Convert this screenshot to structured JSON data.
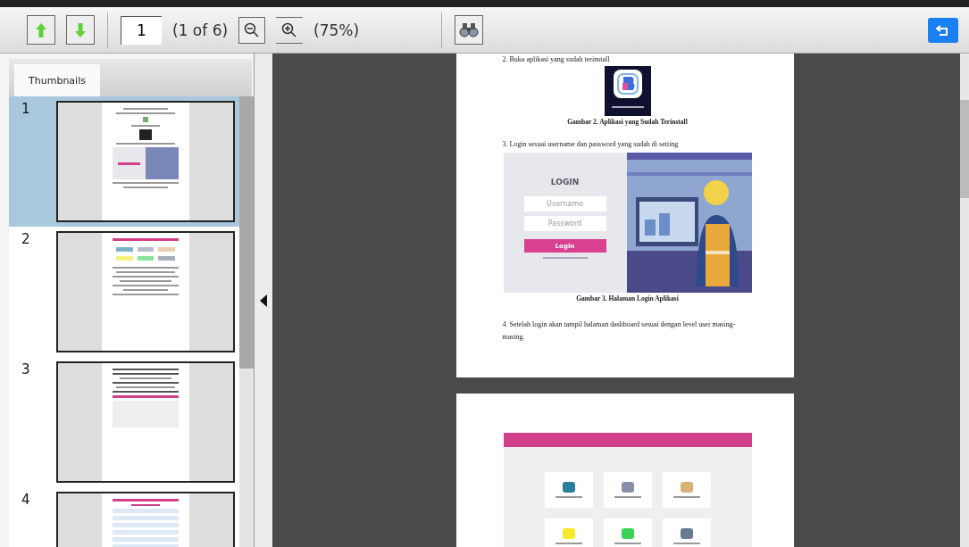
{
  "toolbar": {
    "page_input": "1",
    "page_count": "(1 of 6)",
    "zoom": "(75%)"
  },
  "sidebar": {
    "tabs": [
      {
        "label": "Thumbnails",
        "selected": true
      }
    ],
    "thumbnails": [
      {
        "number": "1",
        "kind": "login",
        "selected": true
      },
      {
        "number": "2",
        "kind": "dashboard",
        "selected": false
      },
      {
        "number": "3",
        "kind": "profile",
        "selected": false
      },
      {
        "number": "4",
        "kind": "table",
        "selected": false
      }
    ]
  },
  "document": {
    "pages": [
      {
        "kind": "login",
        "intro": "2. Buka aplikasi yang sudah terinstall",
        "caption_1": "Gambar 2. Aplikasi yang Sudah Terinstall",
        "step_3": "3. Login sesuai username dan password yang sudah di setting",
        "login_title": "LOGIN",
        "username_placeholder": "Username",
        "password_placeholder": "Password",
        "login_button": "Login",
        "caption_2": "Gambar 3. Halaman Login Aplikasi",
        "step_4": "4. Setelah login akan tampil halaman dashboard sesuai dengan level user masing-masing."
      },
      {
        "kind": "dashboard"
      }
    ]
  }
}
